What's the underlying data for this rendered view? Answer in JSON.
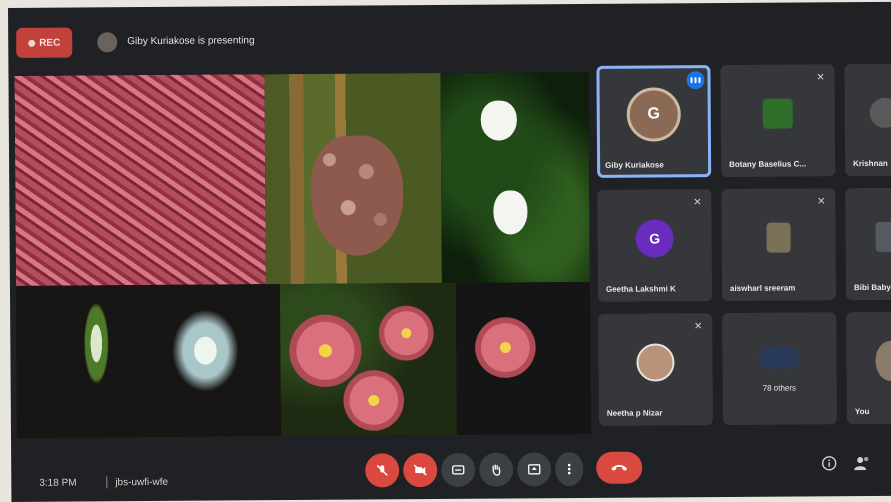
{
  "top_bar": {
    "rec_label": "REC",
    "presenting_text": "Giby Kuriakose is presenting"
  },
  "tiles": [
    {
      "name": "Giby Kuriakose",
      "initial": "G",
      "avatar_color": "#8a6a55",
      "active": true
    },
    {
      "name": "Botany Baselius C...",
      "initial": "",
      "avatar_color": "#2f6e2a"
    },
    {
      "name": "Krishnan",
      "initial": "",
      "avatar_color": "#5a5a5a"
    },
    {
      "name": "Geetha Lakshmi K",
      "initial": "G",
      "avatar_color": "#6a2bbf"
    },
    {
      "name": "aiswharl sreeram",
      "initial": "",
      "avatar_color": "#7a7257"
    },
    {
      "name": "Bibi Baby",
      "initial": "",
      "avatar_color": "#555a60"
    },
    {
      "name": "Neetha p Nizar",
      "initial": "",
      "avatar_color": "#b9927a"
    },
    {
      "name": "78 others",
      "initial": "",
      "avatar_color": "#2a3a5a"
    },
    {
      "name": "You",
      "initial": "",
      "avatar_color": "#8a7a6a"
    }
  ],
  "bottom_bar": {
    "time": "3:18 PM",
    "meeting_code": "jbs-uwfi-wfe"
  },
  "icons": {
    "mic": "mic-off-icon",
    "camera": "camera-off-icon",
    "captions": "captions-icon",
    "hand": "raise-hand-icon",
    "present": "present-screen-icon",
    "more": "more-options-icon",
    "end": "end-call-icon",
    "info": "info-icon",
    "people": "people-icon"
  },
  "colors": {
    "accent": "#8ab4f8",
    "danger": "#d9493f",
    "tile_bg": "#35373b"
  }
}
